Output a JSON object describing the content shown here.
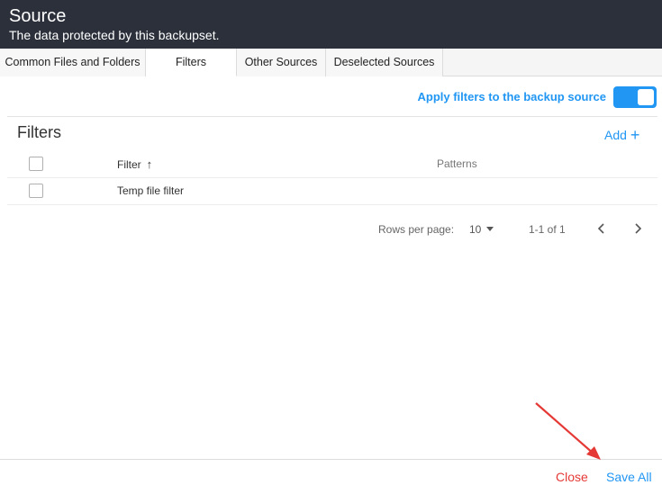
{
  "header": {
    "title": "Source",
    "subtitle": "The data protected by this backupset."
  },
  "tabs": [
    {
      "label": "Common Files and Folders",
      "active": false
    },
    {
      "label": "Filters",
      "active": true
    },
    {
      "label": "Other Sources",
      "active": false
    },
    {
      "label": "Deselected Sources",
      "active": false
    }
  ],
  "apply_filters": {
    "label": "Apply filters to the backup source",
    "enabled": true
  },
  "filters": {
    "title": "Filters",
    "add_label": "Add",
    "columns": {
      "filter": "Filter",
      "patterns": "Patterns"
    },
    "rows": [
      {
        "filter": "Temp file filter",
        "patterns": ""
      }
    ]
  },
  "pagination": {
    "rows_per_page_label": "Rows per page:",
    "rows_per_page": "10",
    "range": "1-1 of 1"
  },
  "footer": {
    "close_label": "Close",
    "save_label": "Save All"
  },
  "colors": {
    "header_bg": "#2b303b",
    "accent": "#2196f3",
    "danger": "#e53935",
    "annotation": "#e53935"
  }
}
